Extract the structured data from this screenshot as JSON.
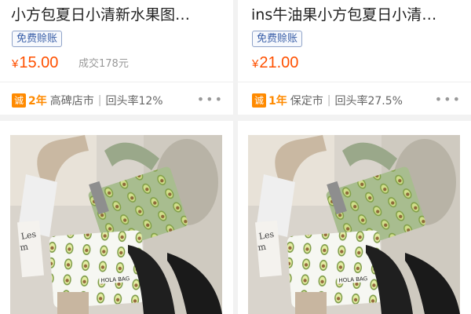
{
  "products": [
    {
      "title": "小方包夏日小清新水果图…",
      "badge": "免费赊账",
      "price_symbol": "¥",
      "price": "15.00",
      "sold": "成交178元",
      "trust_icon": "诚",
      "years": "2年",
      "location": "高碑店市",
      "repurchase": "回头率12%",
      "more": "•••"
    },
    {
      "title": "ins牛油果小方包夏日小清…",
      "badge": "免费赊账",
      "price_symbol": "¥",
      "price": "21.00",
      "sold": "",
      "trust_icon": "诚",
      "years": "1年",
      "location": "保定市",
      "repurchase": "回头率27.5%",
      "more": "•••"
    }
  ],
  "image_cards": [
    {
      "image": "avocado-bags-photo",
      "bag_label": "HOLA BAG"
    },
    {
      "image": "avocado-bags-photo",
      "bag_label": "HOLA BAG"
    }
  ],
  "colors": {
    "price": "#ff5000",
    "badge_text": "#3a5fa8",
    "trust_orange": "#ff8a00"
  }
}
